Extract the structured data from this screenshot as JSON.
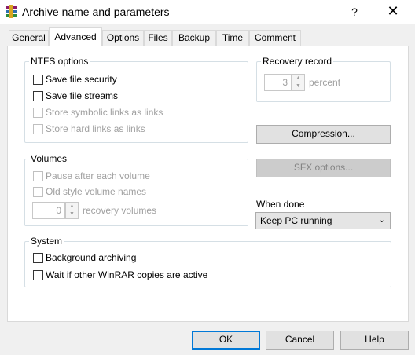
{
  "window": {
    "title": "Archive name and parameters",
    "help_glyph": "?",
    "close_glyph": "✕"
  },
  "tabs": [
    "General",
    "Advanced",
    "Options",
    "Files",
    "Backup",
    "Time",
    "Comment"
  ],
  "active_tab": "Advanced",
  "ntfs": {
    "title": "NTFS options",
    "save_security": "Save file security",
    "save_streams": "Save file streams",
    "store_symlinks": "Store symbolic links as links",
    "store_hardlinks": "Store hard links as links"
  },
  "recovery": {
    "title": "Recovery record",
    "value": "3",
    "unit": "percent"
  },
  "compression_button": "Compression...",
  "sfx_button": "SFX options...",
  "volumes": {
    "title": "Volumes",
    "pause": "Pause after each volume",
    "old_style": "Old style volume names",
    "recovery_value": "0",
    "recovery_unit": "recovery volumes"
  },
  "when_done": {
    "label": "When done",
    "selected": "Keep PC running"
  },
  "system": {
    "title": "System",
    "background": "Background archiving",
    "wait": "Wait if other WinRAR copies are active"
  },
  "buttons": {
    "ok": "OK",
    "cancel": "Cancel",
    "help": "Help"
  },
  "colors": {
    "accent": "#0078d7",
    "window_bg": "#f0f0f0",
    "panel_bg": "#ffffff",
    "disabled_text": "#a0a0a0"
  },
  "icons": {
    "app": "winrar-books-icon",
    "spin_up": "spin-up-arrow",
    "spin_down": "spin-down-arrow",
    "dropdown": "chevron-down-icon"
  }
}
